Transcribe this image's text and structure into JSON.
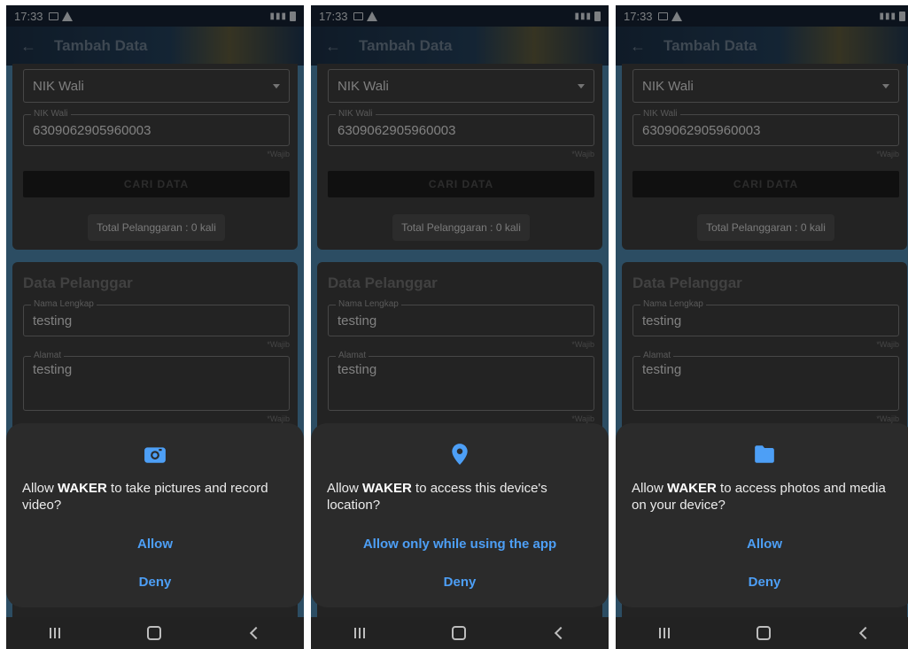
{
  "status_bar": {
    "time": "17:33"
  },
  "app_bar": {
    "title": "Tambah Data"
  },
  "form": {
    "select_value": "NIK Wali",
    "nik_label": "NIK Wali",
    "nik_value": "6309062905960003",
    "required_hint": "*Wajib",
    "search_button": "CARI DATA",
    "violations": "Total Pelanggaran : 0 kali",
    "section_title": "Data Pelanggar",
    "name_label": "Nama Lengkap",
    "name_value": "testing",
    "address_label": "Alamat",
    "address_value": "testing"
  },
  "colors": {
    "accent": "#4d9ff6",
    "dialog_bg": "#2b2b2b"
  },
  "dialogs": [
    {
      "icon": "camera-icon",
      "prefix": "Allow ",
      "app": "WAKER",
      "suffix": " to take pictures and record video?",
      "allow_label": "Allow",
      "deny_label": "Deny"
    },
    {
      "icon": "location-icon",
      "prefix": "Allow ",
      "app": "WAKER",
      "suffix": " to access this device's location?",
      "allow_label": "Allow only while using the app",
      "deny_label": "Deny"
    },
    {
      "icon": "folder-icon",
      "prefix": "Allow ",
      "app": "WAKER",
      "suffix": " to access photos and media on your device?",
      "allow_label": "Allow",
      "deny_label": "Deny"
    }
  ]
}
